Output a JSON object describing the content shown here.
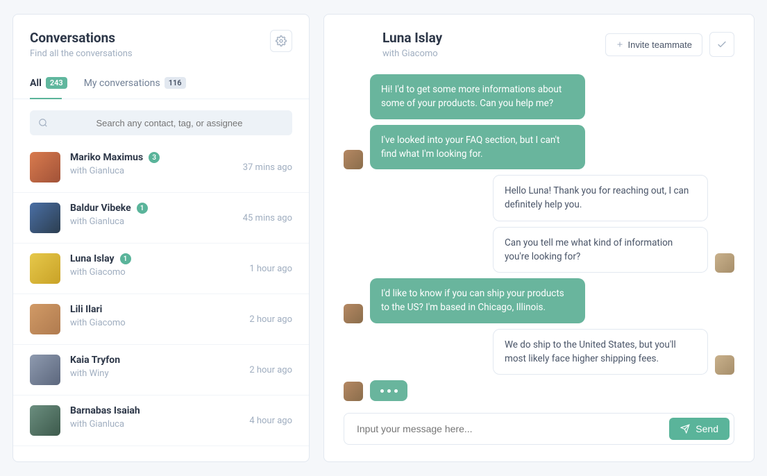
{
  "sidebar": {
    "title": "Conversations",
    "subtitle": "Find all the conversations",
    "tabs": [
      {
        "label": "All",
        "count": "243"
      },
      {
        "label": "My conversations",
        "count": "116"
      }
    ],
    "search_placeholder": "Search any contact, tag, or assignee",
    "items": [
      {
        "name": "Mariko Maximus",
        "badge": "3",
        "with": "with Gianluca",
        "time": "37 mins ago"
      },
      {
        "name": "Baldur Vibeke",
        "badge": "1",
        "with": "with Gianluca",
        "time": "45 mins ago"
      },
      {
        "name": "Luna Islay",
        "badge": "1",
        "with": "with Giacomo",
        "time": "1 hour ago"
      },
      {
        "name": "Lili Ilari",
        "badge": "",
        "with": "with Giacomo",
        "time": "2 hour ago"
      },
      {
        "name": "Kaia Tryfon",
        "badge": "",
        "with": "with Winy",
        "time": "2 hour ago"
      },
      {
        "name": "Barnabas Isaiah",
        "badge": "",
        "with": "with Gianluca",
        "time": "4 hour ago"
      }
    ]
  },
  "chat": {
    "title": "Luna Islay",
    "with": "with Giacomo",
    "invite_label": "Invite teammate",
    "messages": [
      {
        "side": "left",
        "text": "Hi! I'd to get some more informations about some of your products. Can you help me?"
      },
      {
        "side": "left",
        "text": "I've looked into your FAQ section, but I can't find what I'm looking for."
      },
      {
        "side": "right",
        "text": "Hello Luna! Thank you for reaching out, I can definitely help you."
      },
      {
        "side": "right",
        "text": "Can you tell me what kind of information you're looking for?"
      },
      {
        "side": "left",
        "text": "I'd like to know if you can ship your products to the US? I'm based in Chicago, Illinois."
      },
      {
        "side": "right",
        "text": "We do ship to the United States, but you'll most likely face higher shipping fees."
      }
    ],
    "composer_placeholder": "Input your message here...",
    "send_label": "Send"
  }
}
